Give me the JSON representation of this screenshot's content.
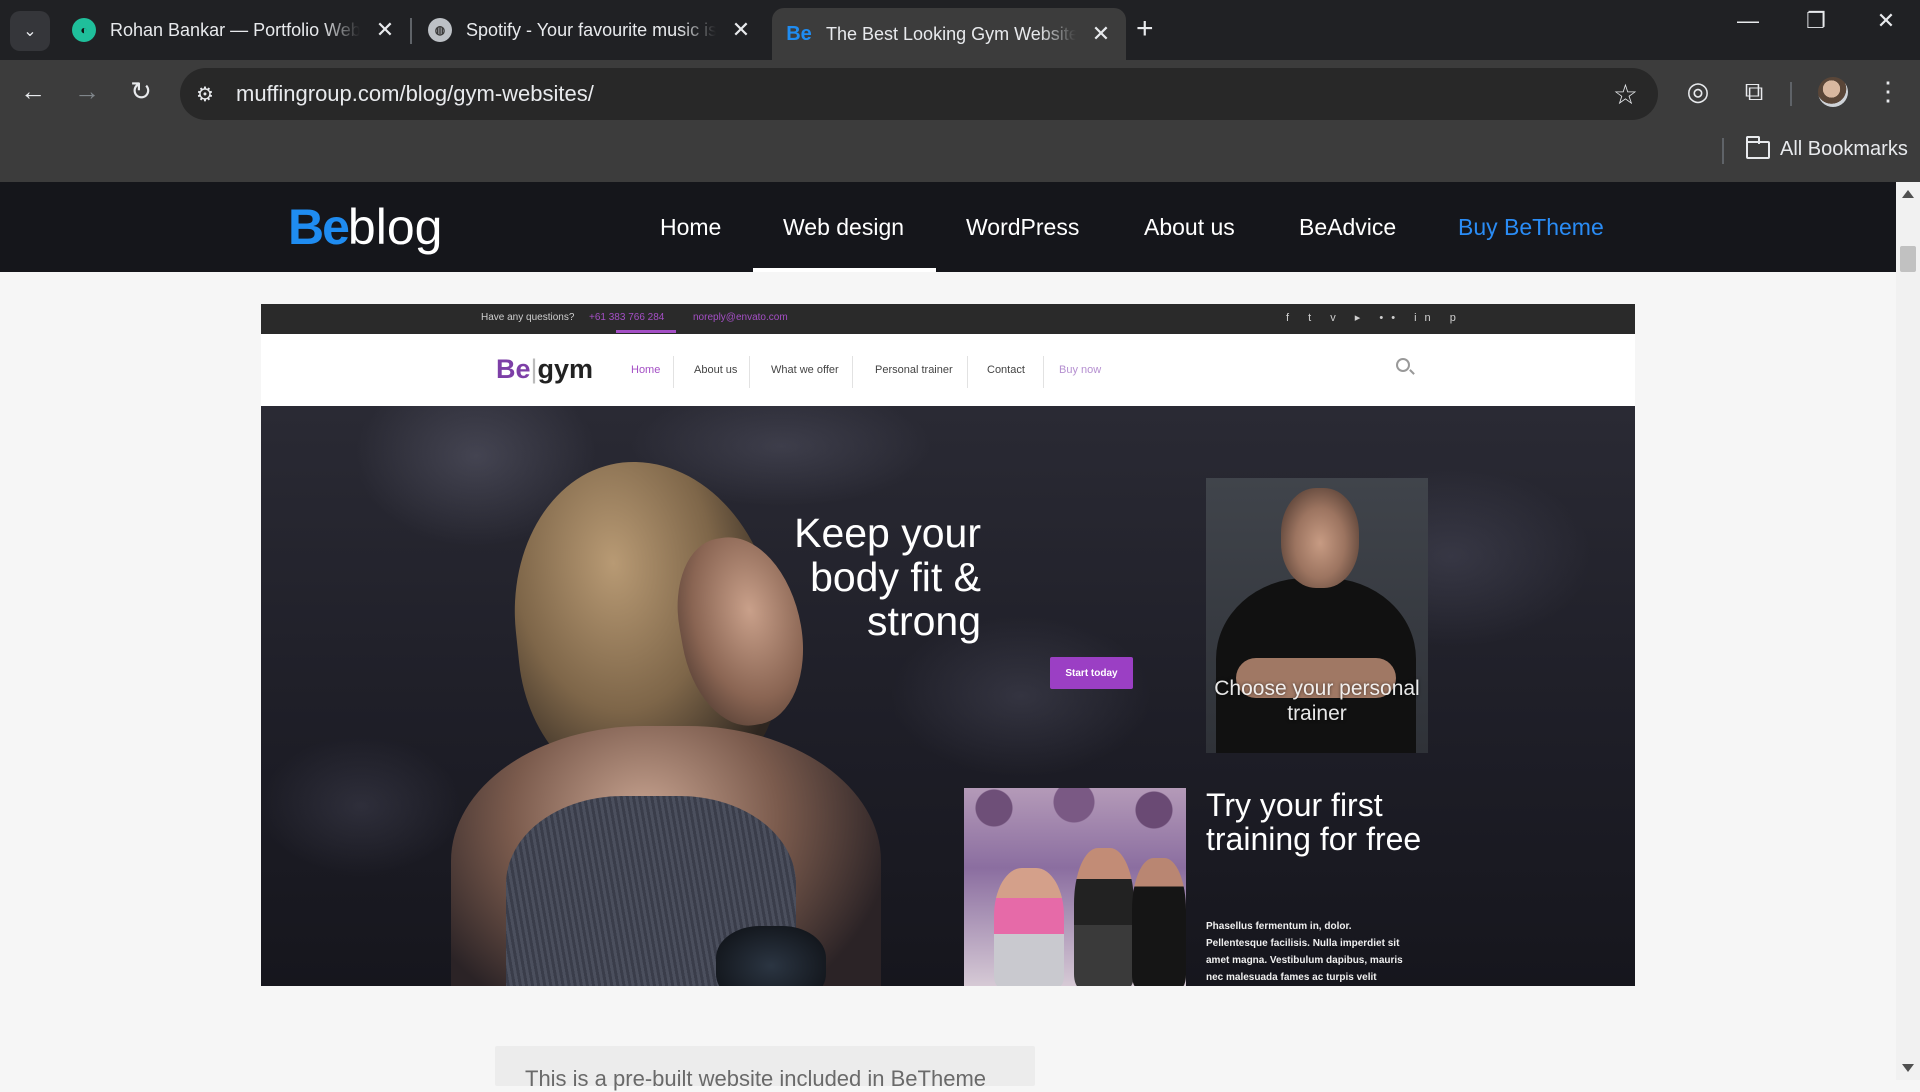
{
  "browser": {
    "tabs": [
      {
        "title": "Rohan Bankar — Portfolio Website",
        "favicon": "rb-icon",
        "active": false
      },
      {
        "title": "Spotify - Your favourite music is here",
        "favicon": "globe-icon",
        "active": false
      },
      {
        "title": "The Best Looking Gym Websites",
        "favicon": "Be",
        "active": true
      }
    ],
    "new_tab_label": "+",
    "url": "muffingroup.com/blog/gym-websites/",
    "bookmarks_label": "All Bookmarks"
  },
  "site": {
    "logo_be": "Be",
    "logo_blog": "blog",
    "nav": [
      "Home",
      "Web design",
      "WordPress",
      "About us",
      "BeAdvice",
      "Buy BeTheme"
    ],
    "active_nav": "Web design",
    "accent_color": "#2a8cf5"
  },
  "gym": {
    "topbar_question": "Have any questions?",
    "topbar_phone": "+61 383 766 284",
    "topbar_email": "noreply@envato.com",
    "social": "f  t  v  ▸  ••  in  p",
    "logo_be": "Be",
    "logo_bar": "|",
    "logo_gym": "gym",
    "nav": [
      "Home",
      "About us",
      "What we offer",
      "Personal trainer",
      "Contact",
      "Buy now"
    ],
    "hero_title": "Keep your body fit & strong",
    "hero_button": "Start today",
    "trainer_text": "Choose your personal trainer",
    "try_title": "Try your first training for free",
    "try_text": "Phasellus fermentum in, dolor. Pellentesque facilisis. Nulla imperdiet sit amet magna. Vestibulum dapibus, mauris nec malesuada fames ac turpis velit",
    "accent_color": "#9b3fc4"
  },
  "caption": "This is a pre-built website included in BeTheme"
}
